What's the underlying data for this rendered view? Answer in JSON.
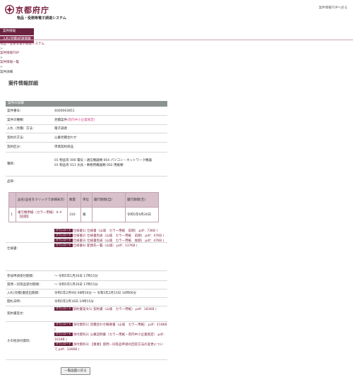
{
  "header": {
    "logo_text": "京都府庁",
    "system_name": "物品・役務等電子調達システム",
    "top_link": "案件情報TOPへ戻る"
  },
  "tabs": [
    "案件情報",
    "入札(見積)結果情報"
  ],
  "breadcrumb": {
    "items": [
      "物品・役務等電子調達システム",
      "案件情報TOP",
      "案件情報一覧",
      "案件詳細"
    ],
    "separator": ">"
  },
  "page_title": "案件情報詳細",
  "section_title": "案件の詳細",
  "details": {
    "case_number_label": "案件番号：",
    "case_number": "4000063851",
    "case_type_label": "案件の種類：",
    "case_type": "見積案件",
    "case_type_note": "(府内中小企業限定)",
    "bid_method_label": "入札（見積）方法：",
    "bid_method": "電子調達",
    "contract_method_label": "契約の方法：",
    "contract_method": "公募見積合わせ",
    "contract_category_label": "契約区分：",
    "contract_category": "単価契約商品",
    "type_label": "種目：",
    "type_line1": "01  物品等  006  電気・通信機器類  004  パソコン・ネットワーク機器",
    "type_line2": "01  物品等  011  文具・事務用機器類  002  用紙類",
    "item_label": "品目："
  },
  "item_table": {
    "headers": [
      "",
      "品名(品名をクリックで詳細表示)",
      "数量",
      "単位",
      "履行期間(自)",
      "履行期間(至)"
    ],
    "rows": [
      [
        "1",
        "複写機用紙（カラー用紙）Ａ４【前期】",
        "310",
        "箱",
        "",
        "令和5年9月30日"
      ]
    ]
  },
  "spec": {
    "label": "仕様書：",
    "dl_label": "ダウンロード",
    "files": [
      "仕様書1( 仕様書（山城　カラー用紙　前期）.pdf：73KB )",
      "仕様書2( 仕様書別表（山城　カラー用紙　前期）.pdf：47KB )",
      "仕様書3( 仕様書別表（山城　カラー用紙　後期）.pdf：47KB )",
      "仕様書4( 配達先一覧（山城）.pdf：137KB )"
    ]
  },
  "schedule": {
    "apply_label": "参加申請受付期間：",
    "apply_value": "～ 令和5年1月26日 17時15分",
    "question_label": "質問・同等品受付期間：",
    "question_value": "～ 令和5年1月26日 17時15分",
    "bid_label": "入札(見積)書提出期間：",
    "bid_value": "令和5年2月9日 08時30分 ～ 令和5年2月15日 10時00分",
    "open_label": "開札日時：",
    "open_value": "令和5年2月16日 10時15分"
  },
  "contract_doc": {
    "label": "契約書案文：",
    "file": "契約書案文1( 契約書（山城　カラー用紙）.pdf：181KB )"
  },
  "other_docs": {
    "label": "その他添付資料：",
    "files": [
      "添付資料1( 見積合わせ概要書（山城　カラー用紙）.pdf：410KB )",
      "添付資料2( 公募説明書（カラー用紙・府内中小企業限定）.pdf：161KB )",
      "添付資料3( 【重要】質問・同等品申請の回答方法の変更について.pdf：336KB )"
    ]
  },
  "back_button": "一覧画面に戻る",
  "colors": {
    "brand": "#7a1f3d",
    "section_header": "#8c9191",
    "table_header": "#d9c1cc",
    "accent_pink": "#d4478a"
  }
}
